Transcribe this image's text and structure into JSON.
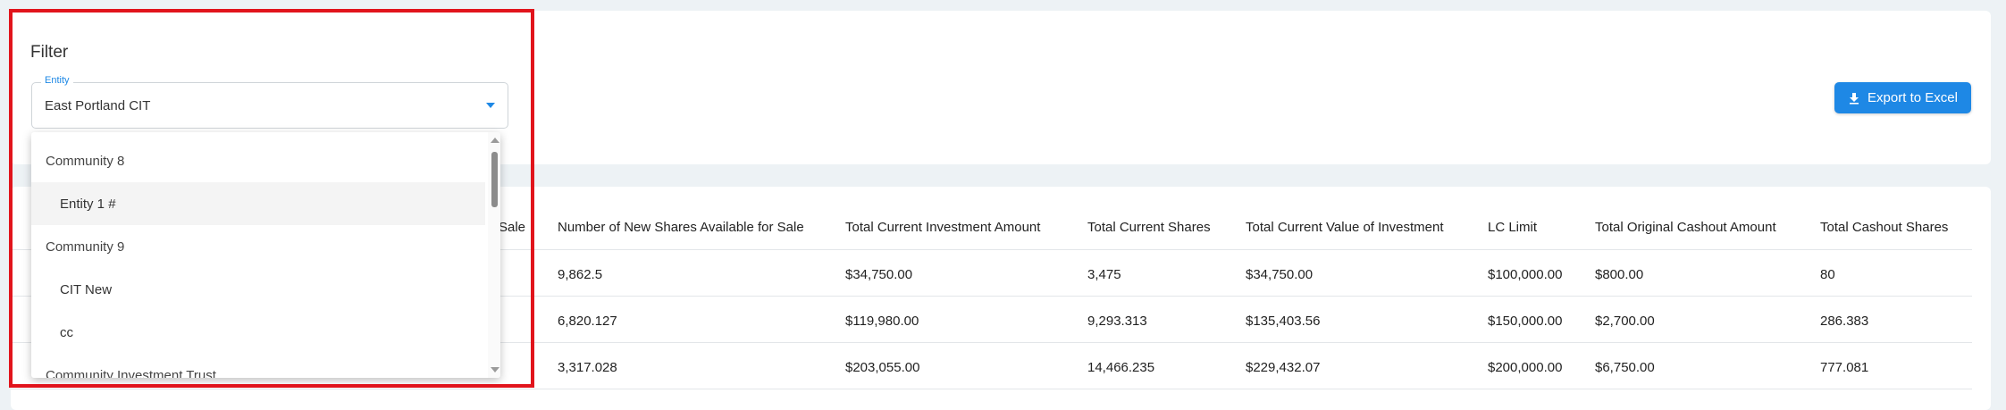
{
  "filter": {
    "title": "Filter",
    "entity_label": "Entity",
    "entity_value": "East Portland CIT"
  },
  "export_button": {
    "label": "Export to Excel"
  },
  "table": {
    "partial_header": "Sale",
    "headers": [
      "Number of New Shares Available for Sale",
      "Total Current Investment Amount",
      "Total Current Shares",
      "Total Current Value of Investment",
      "LC Limit",
      "Total Original Cashout Amount",
      "Total Cashout Shares"
    ],
    "rows": [
      [
        "9,862.5",
        "$34,750.00",
        "3,475",
        "$34,750.00",
        "$100,000.00",
        "$800.00",
        "80"
      ],
      [
        "6,820.127",
        "$119,980.00",
        "9,293.313",
        "$135,403.56",
        "$150,000.00",
        "$2,700.00",
        "286.383"
      ],
      [
        "3,317.028",
        "$203,055.00",
        "14,466.235",
        "$229,432.07",
        "$200,000.00",
        "$6,750.00",
        "777.081"
      ]
    ]
  },
  "dropdown": {
    "items": [
      {
        "label": "Community 8",
        "type": "group"
      },
      {
        "label": "Entity 1 #",
        "type": "child",
        "active": true
      },
      {
        "label": "Community 9",
        "type": "group"
      },
      {
        "label": "CIT New",
        "type": "child"
      },
      {
        "label": "cc",
        "type": "child"
      },
      {
        "label": "Community Investment Trust",
        "type": "group"
      }
    ]
  },
  "colors": {
    "accent": "#1e88e5",
    "highlight": "#e1141c"
  },
  "icons": {
    "export": "download-icon",
    "dropdown_caret": "chevron-down-icon"
  }
}
